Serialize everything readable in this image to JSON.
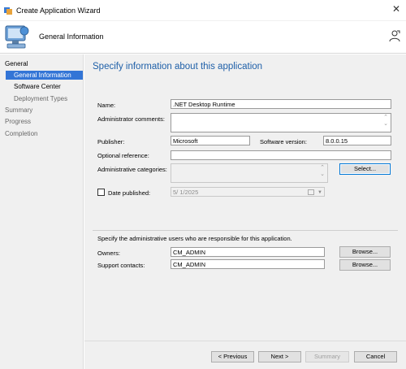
{
  "window": {
    "title": "Create Application Wizard"
  },
  "header": {
    "title": "General Information"
  },
  "nav": {
    "general": "General",
    "general_information": "General Information",
    "software_center": "Software Center",
    "deployment_types": "Deployment Types",
    "summary": "Summary",
    "progress": "Progress",
    "completion": "Completion"
  },
  "main": {
    "heading": "Specify information about this application",
    "name_label": "Name:",
    "name_value": ".NET Desktop Runtime",
    "admin_comments_label": "Administrator comments:",
    "admin_comments_value": "",
    "publisher_label": "Publisher:",
    "publisher_value": "Microsoft",
    "software_version_label": "Software version:",
    "software_version_value": "8.0.0.15",
    "optional_reference_label": "Optional reference:",
    "optional_reference_value": "",
    "admin_categories_label": "Administrative categories:",
    "select_button": "Select...",
    "date_published_label": "Date published:",
    "date_published_value": "5/  1/2025",
    "date_published_checked": false,
    "admin_users_text": "Specify the administrative users who are responsible for this application.",
    "owners_label": "Owners:",
    "owners_value": "CM_ADMIN",
    "support_contacts_label": "Support contacts:",
    "support_contacts_value": "CM_ADMIN",
    "browse_button": "Browse..."
  },
  "footer": {
    "previous": "< Previous",
    "next": "Next >",
    "summary": "Summary",
    "cancel": "Cancel"
  },
  "colors": {
    "nav_selected": "#3375d6",
    "heading": "#1e5fa8",
    "focus_border": "#0078d7"
  }
}
